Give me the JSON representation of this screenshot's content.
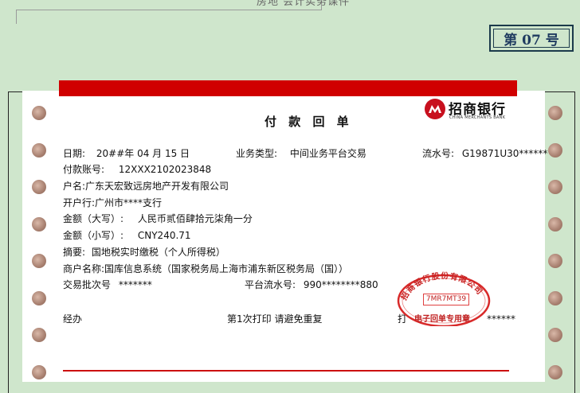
{
  "header": {
    "caption": "房地 会计实务课件",
    "page_label": "第 07 号"
  },
  "slip": {
    "title": "付 款 回 单",
    "bank": {
      "name_cn": "招商银行",
      "name_en": "CHINA MERCHANTS BANK"
    },
    "date_label": "日期:",
    "date_value": "20##年 04 月 15 日",
    "biz_type_label": "业务类型:",
    "biz_type_value": "中间业务平台交易",
    "serial_label": "流水号:",
    "serial_value": "G19871U30******",
    "account_label": "付款账号:",
    "account_value": "12XXX2102023848",
    "name_label": "户名:",
    "name_value": "广东天宏致远房地产开发有限公司",
    "bank_branch_label": "开户行:",
    "bank_branch_value": "广州市****支行",
    "amount_upper_label": "金额（大写）:",
    "amount_upper_value": "人民币贰佰肆拾元柒角一分",
    "amount_lower_label": "金额（小写）:",
    "amount_lower_value": "CNY240.71",
    "summary_label": "摘要:",
    "summary_value": "国地税实时缴税（个人所得税）",
    "merchant_label": "商户名称:",
    "merchant_value": "国库信息系统（国家税务局上海市浦东新区税务局（国））",
    "batch_label": "交易批次号",
    "batch_value": "*******",
    "platform_serial_label": "平台流水号:",
    "platform_serial_value": "990********880",
    "handler_label": "经办",
    "print_prefix": "第",
    "print_count": "1",
    "print_suffix": "次打印   请避免重复",
    "printer_label": "打",
    "printer_value": "******"
  },
  "stamp": {
    "ring_text": "招商银行股份有限公司",
    "code": "7MR7MT39",
    "label": "电子回单专用章"
  }
}
